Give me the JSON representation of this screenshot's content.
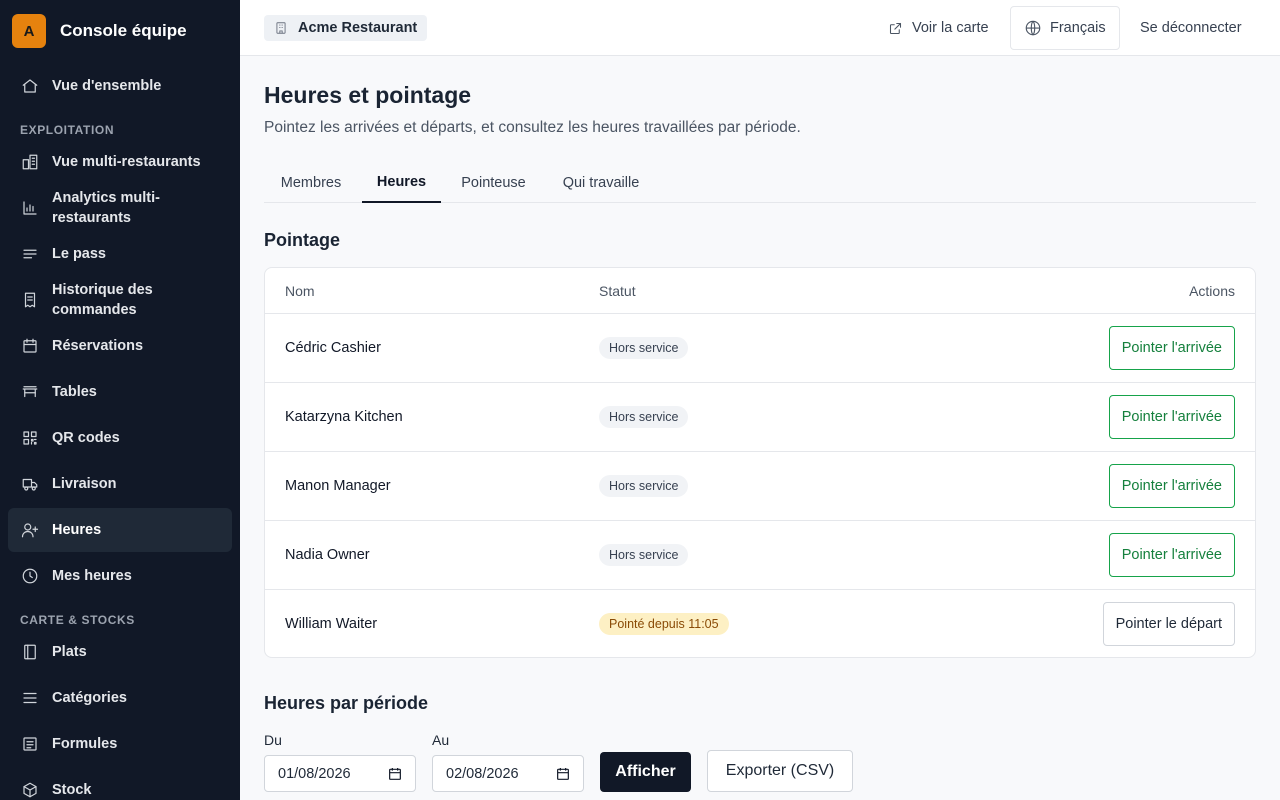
{
  "brand": {
    "logo_letter": "A",
    "title": "Console équipe",
    "logo_color": "#e6820e"
  },
  "sidebar": {
    "top_items": [
      {
        "label": "Vue d'ensemble",
        "icon": "home-icon"
      }
    ],
    "sections": [
      {
        "title": "EXPLOITATION",
        "items": [
          {
            "label": "Vue multi-restaurants",
            "icon": "buildings-icon"
          },
          {
            "label": "Analytics multi-restaurants",
            "icon": "bar-chart-icon"
          },
          {
            "label": "Le pass",
            "icon": "lines-icon"
          },
          {
            "label": "Historique des commandes",
            "icon": "receipt-icon"
          },
          {
            "label": "Réservations",
            "icon": "calendar-icon"
          },
          {
            "label": "Tables",
            "icon": "table-icon"
          },
          {
            "label": "QR codes",
            "icon": "qr-code-icon"
          },
          {
            "label": "Livraison",
            "icon": "truck-icon"
          },
          {
            "label": "Heures",
            "icon": "user-plus-icon",
            "active": true
          },
          {
            "label": "Mes heures",
            "icon": "clock-icon"
          }
        ]
      },
      {
        "title": "CARTE & STOCKS",
        "items": [
          {
            "label": "Plats",
            "icon": "book-icon"
          },
          {
            "label": "Catégories",
            "icon": "menu-lines-icon"
          },
          {
            "label": "Formules",
            "icon": "list-box-icon"
          },
          {
            "label": "Stock",
            "icon": "box-icon"
          }
        ]
      }
    ]
  },
  "topbar": {
    "restaurant": "Acme Restaurant",
    "view_menu": "Voir la carte",
    "language": "Français",
    "logout": "Se déconnecter"
  },
  "page": {
    "title": "Heures et pointage",
    "subtitle": "Pointez les arrivées et départs, et consultez les heures travaillées par période."
  },
  "tabs": [
    {
      "label": "Membres"
    },
    {
      "label": "Heures",
      "active": true
    },
    {
      "label": "Pointeuse"
    },
    {
      "label": "Qui travaille"
    }
  ],
  "pointage": {
    "title": "Pointage",
    "columns": {
      "name": "Nom",
      "status": "Statut",
      "actions": "Actions"
    },
    "rows": [
      {
        "name": "Cédric Cashier",
        "status": "Hors service",
        "action": "Pointer l'arrivée",
        "on_shift": false
      },
      {
        "name": "Katarzyna Kitchen",
        "status": "Hors service",
        "action": "Pointer l'arrivée",
        "on_shift": false
      },
      {
        "name": "Manon Manager",
        "status": "Hors service",
        "action": "Pointer l'arrivée",
        "on_shift": false
      },
      {
        "name": "Nadia Owner",
        "status": "Hors service",
        "action": "Pointer l'arrivée",
        "on_shift": false
      },
      {
        "name": "William Waiter",
        "status": "Pointé depuis 11:05",
        "action": "Pointer le départ",
        "on_shift": true
      }
    ]
  },
  "periode": {
    "title": "Heures par période",
    "from_label": "Du",
    "from_value": "01/08/2026",
    "to_label": "Au",
    "to_value": "02/08/2026",
    "show_button": "Afficher",
    "export_button": "Exporter (CSV)"
  }
}
